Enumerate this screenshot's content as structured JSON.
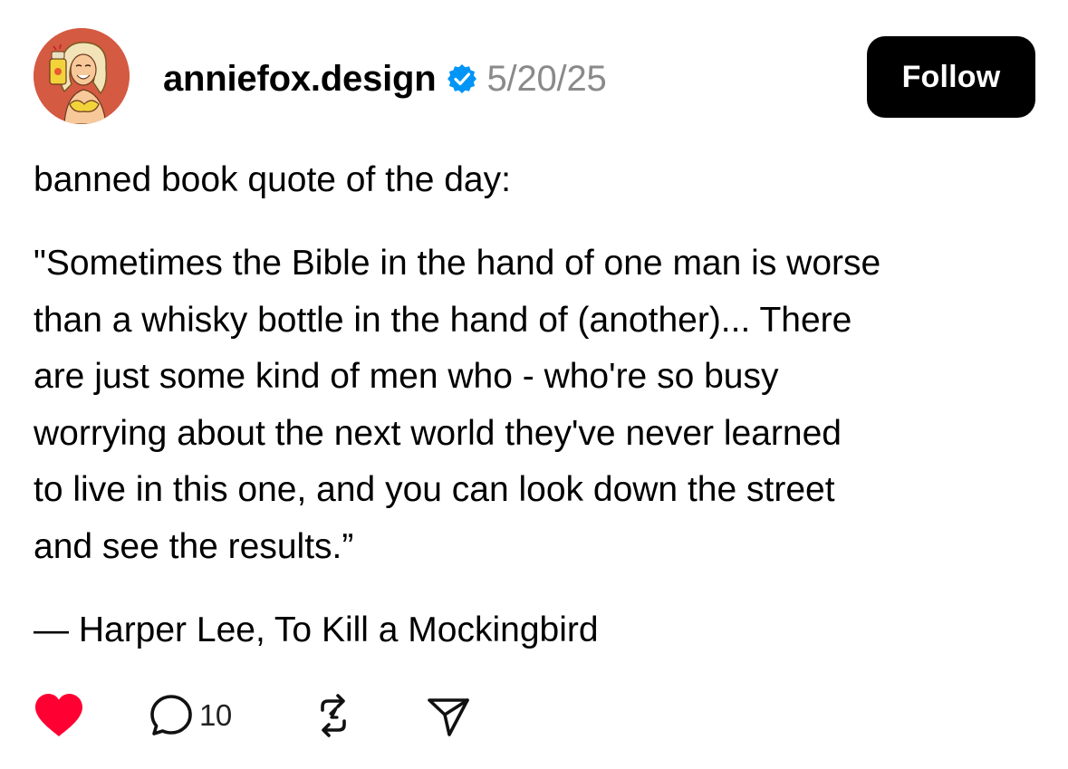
{
  "post": {
    "username": "anniefox.design",
    "date": "5/20/25",
    "follow_label": "Follow",
    "intro": "banned book quote of the day:",
    "quote_lines": [
      "\"Sometimes the Bible in the hand of one man is worse",
      "than a whisky bottle in the hand of (another)... There",
      "are just some kind of men who - who're so busy",
      "worrying about the next world they've never learned",
      "to live in this one, and you can look down the street",
      "and see the results.”"
    ],
    "attribution": "— Harper Lee, To Kill a Mockingbird"
  },
  "actions": {
    "like": {
      "icon": "heart-icon",
      "liked": true,
      "color": "#ff0033"
    },
    "comment": {
      "icon": "comment-icon",
      "count": "10"
    },
    "repost": {
      "icon": "repost-icon"
    },
    "share": {
      "icon": "share-icon"
    }
  },
  "colors": {
    "verified": "#0095f6",
    "date": "#8a8a8a",
    "follow_bg": "#000000",
    "follow_text": "#ffffff"
  }
}
